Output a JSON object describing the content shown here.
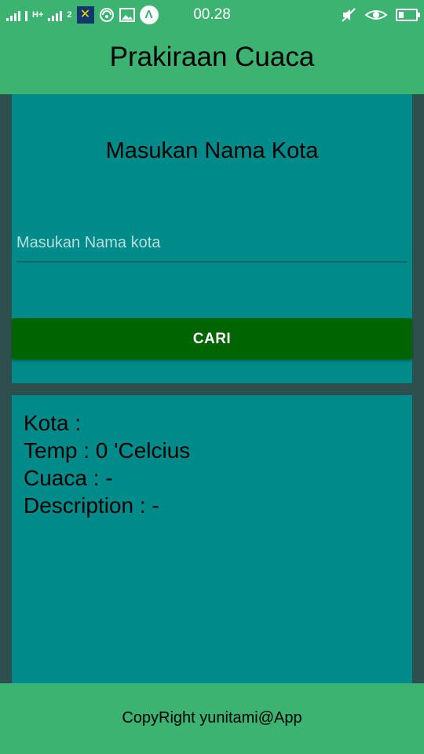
{
  "status_bar": {
    "time": "00.28",
    "network_small_1": "H+",
    "network_small_2": "2",
    "sim_glyph": "✕",
    "app_glyph": "Λ",
    "icons": [
      "signal-icon",
      "signal-icon",
      "sim-operator-icon",
      "wifi-hotspot-icon",
      "image-icon",
      "app-icon",
      "mute-icon",
      "eye-icon",
      "battery-icon"
    ]
  },
  "app_bar": {
    "title": "Prakiraan Cuaca"
  },
  "search_card": {
    "heading": "Masukan Nama Kota",
    "input_placeholder": "Masukan Nama kota",
    "input_value": "",
    "button_label": "CARI"
  },
  "result_card": {
    "city_line": "Kota :",
    "temp_line": "Temp : 0 'Celcius",
    "weather_line": "Cuaca : -",
    "description_line": "Description : -"
  },
  "footer": {
    "text": "CopyRight yunitami@App"
  },
  "colors": {
    "app_bar": "#3CB371",
    "background": "#2F4F4F",
    "card": "#008B8B",
    "button": "#006400"
  }
}
